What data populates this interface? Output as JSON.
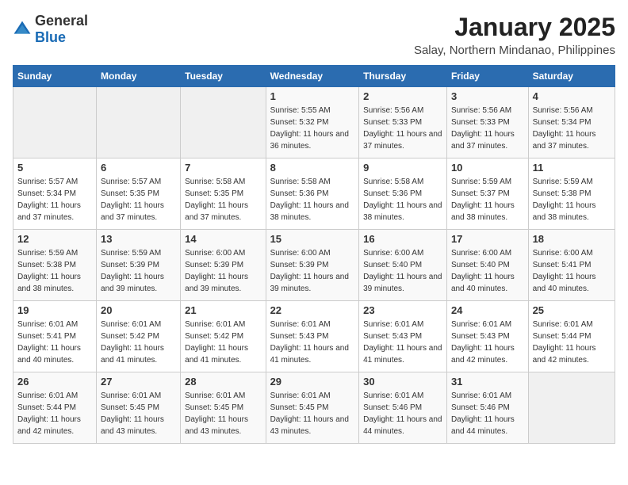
{
  "logo": {
    "text_general": "General",
    "text_blue": "Blue"
  },
  "title": "January 2025",
  "location": "Salay, Northern Mindanao, Philippines",
  "headers": [
    "Sunday",
    "Monday",
    "Tuesday",
    "Wednesday",
    "Thursday",
    "Friday",
    "Saturday"
  ],
  "weeks": [
    [
      {
        "day": "",
        "sunrise": "",
        "sunset": "",
        "daylight": ""
      },
      {
        "day": "",
        "sunrise": "",
        "sunset": "",
        "daylight": ""
      },
      {
        "day": "",
        "sunrise": "",
        "sunset": "",
        "daylight": ""
      },
      {
        "day": "1",
        "sunrise": "Sunrise: 5:55 AM",
        "sunset": "Sunset: 5:32 PM",
        "daylight": "Daylight: 11 hours and 36 minutes."
      },
      {
        "day": "2",
        "sunrise": "Sunrise: 5:56 AM",
        "sunset": "Sunset: 5:33 PM",
        "daylight": "Daylight: 11 hours and 37 minutes."
      },
      {
        "day": "3",
        "sunrise": "Sunrise: 5:56 AM",
        "sunset": "Sunset: 5:33 PM",
        "daylight": "Daylight: 11 hours and 37 minutes."
      },
      {
        "day": "4",
        "sunrise": "Sunrise: 5:56 AM",
        "sunset": "Sunset: 5:34 PM",
        "daylight": "Daylight: 11 hours and 37 minutes."
      }
    ],
    [
      {
        "day": "5",
        "sunrise": "Sunrise: 5:57 AM",
        "sunset": "Sunset: 5:34 PM",
        "daylight": "Daylight: 11 hours and 37 minutes."
      },
      {
        "day": "6",
        "sunrise": "Sunrise: 5:57 AM",
        "sunset": "Sunset: 5:35 PM",
        "daylight": "Daylight: 11 hours and 37 minutes."
      },
      {
        "day": "7",
        "sunrise": "Sunrise: 5:58 AM",
        "sunset": "Sunset: 5:35 PM",
        "daylight": "Daylight: 11 hours and 37 minutes."
      },
      {
        "day": "8",
        "sunrise": "Sunrise: 5:58 AM",
        "sunset": "Sunset: 5:36 PM",
        "daylight": "Daylight: 11 hours and 38 minutes."
      },
      {
        "day": "9",
        "sunrise": "Sunrise: 5:58 AM",
        "sunset": "Sunset: 5:36 PM",
        "daylight": "Daylight: 11 hours and 38 minutes."
      },
      {
        "day": "10",
        "sunrise": "Sunrise: 5:59 AM",
        "sunset": "Sunset: 5:37 PM",
        "daylight": "Daylight: 11 hours and 38 minutes."
      },
      {
        "day": "11",
        "sunrise": "Sunrise: 5:59 AM",
        "sunset": "Sunset: 5:38 PM",
        "daylight": "Daylight: 11 hours and 38 minutes."
      }
    ],
    [
      {
        "day": "12",
        "sunrise": "Sunrise: 5:59 AM",
        "sunset": "Sunset: 5:38 PM",
        "daylight": "Daylight: 11 hours and 38 minutes."
      },
      {
        "day": "13",
        "sunrise": "Sunrise: 5:59 AM",
        "sunset": "Sunset: 5:39 PM",
        "daylight": "Daylight: 11 hours and 39 minutes."
      },
      {
        "day": "14",
        "sunrise": "Sunrise: 6:00 AM",
        "sunset": "Sunset: 5:39 PM",
        "daylight": "Daylight: 11 hours and 39 minutes."
      },
      {
        "day": "15",
        "sunrise": "Sunrise: 6:00 AM",
        "sunset": "Sunset: 5:39 PM",
        "daylight": "Daylight: 11 hours and 39 minutes."
      },
      {
        "day": "16",
        "sunrise": "Sunrise: 6:00 AM",
        "sunset": "Sunset: 5:40 PM",
        "daylight": "Daylight: 11 hours and 39 minutes."
      },
      {
        "day": "17",
        "sunrise": "Sunrise: 6:00 AM",
        "sunset": "Sunset: 5:40 PM",
        "daylight": "Daylight: 11 hours and 40 minutes."
      },
      {
        "day": "18",
        "sunrise": "Sunrise: 6:00 AM",
        "sunset": "Sunset: 5:41 PM",
        "daylight": "Daylight: 11 hours and 40 minutes."
      }
    ],
    [
      {
        "day": "19",
        "sunrise": "Sunrise: 6:01 AM",
        "sunset": "Sunset: 5:41 PM",
        "daylight": "Daylight: 11 hours and 40 minutes."
      },
      {
        "day": "20",
        "sunrise": "Sunrise: 6:01 AM",
        "sunset": "Sunset: 5:42 PM",
        "daylight": "Daylight: 11 hours and 41 minutes."
      },
      {
        "day": "21",
        "sunrise": "Sunrise: 6:01 AM",
        "sunset": "Sunset: 5:42 PM",
        "daylight": "Daylight: 11 hours and 41 minutes."
      },
      {
        "day": "22",
        "sunrise": "Sunrise: 6:01 AM",
        "sunset": "Sunset: 5:43 PM",
        "daylight": "Daylight: 11 hours and 41 minutes."
      },
      {
        "day": "23",
        "sunrise": "Sunrise: 6:01 AM",
        "sunset": "Sunset: 5:43 PM",
        "daylight": "Daylight: 11 hours and 41 minutes."
      },
      {
        "day": "24",
        "sunrise": "Sunrise: 6:01 AM",
        "sunset": "Sunset: 5:43 PM",
        "daylight": "Daylight: 11 hours and 42 minutes."
      },
      {
        "day": "25",
        "sunrise": "Sunrise: 6:01 AM",
        "sunset": "Sunset: 5:44 PM",
        "daylight": "Daylight: 11 hours and 42 minutes."
      }
    ],
    [
      {
        "day": "26",
        "sunrise": "Sunrise: 6:01 AM",
        "sunset": "Sunset: 5:44 PM",
        "daylight": "Daylight: 11 hours and 42 minutes."
      },
      {
        "day": "27",
        "sunrise": "Sunrise: 6:01 AM",
        "sunset": "Sunset: 5:45 PM",
        "daylight": "Daylight: 11 hours and 43 minutes."
      },
      {
        "day": "28",
        "sunrise": "Sunrise: 6:01 AM",
        "sunset": "Sunset: 5:45 PM",
        "daylight": "Daylight: 11 hours and 43 minutes."
      },
      {
        "day": "29",
        "sunrise": "Sunrise: 6:01 AM",
        "sunset": "Sunset: 5:45 PM",
        "daylight": "Daylight: 11 hours and 43 minutes."
      },
      {
        "day": "30",
        "sunrise": "Sunrise: 6:01 AM",
        "sunset": "Sunset: 5:46 PM",
        "daylight": "Daylight: 11 hours and 44 minutes."
      },
      {
        "day": "31",
        "sunrise": "Sunrise: 6:01 AM",
        "sunset": "Sunset: 5:46 PM",
        "daylight": "Daylight: 11 hours and 44 minutes."
      },
      {
        "day": "",
        "sunrise": "",
        "sunset": "",
        "daylight": ""
      }
    ]
  ]
}
